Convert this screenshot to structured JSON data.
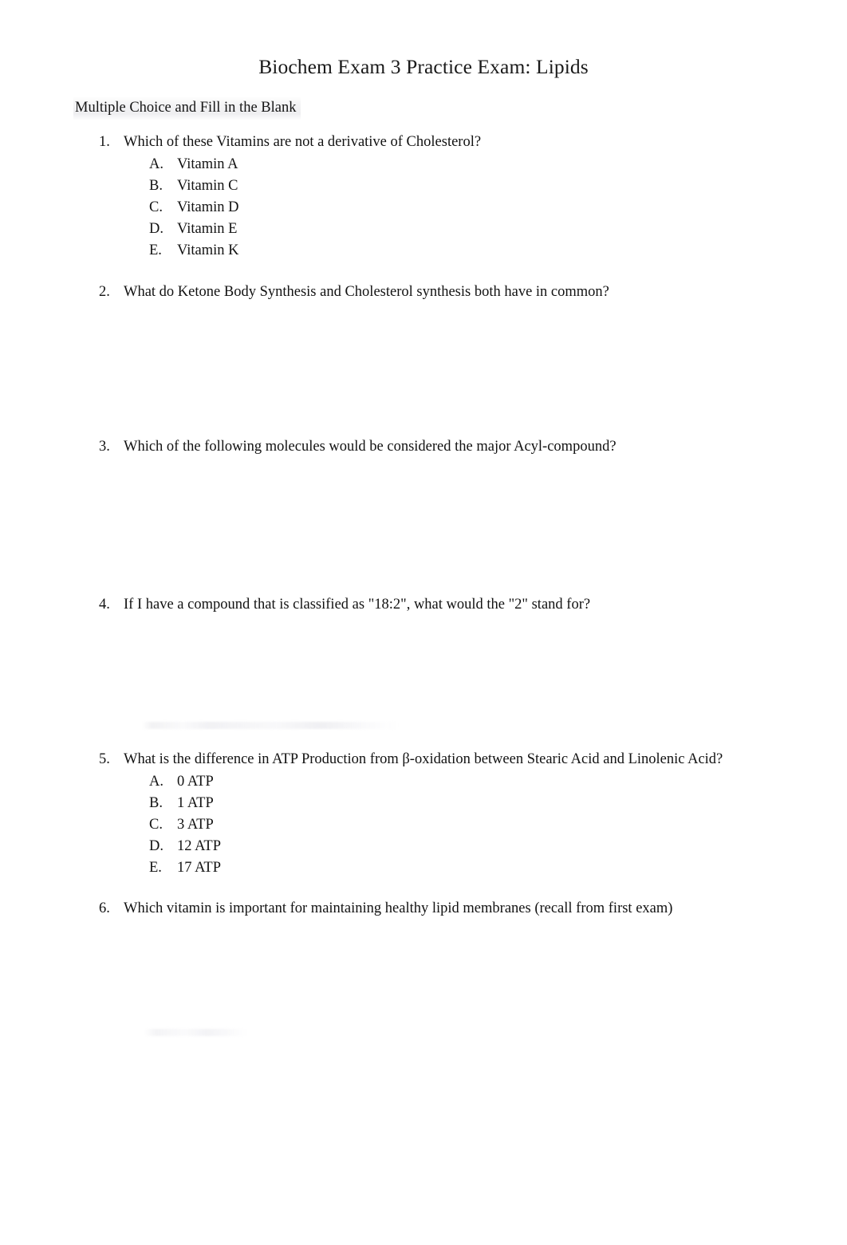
{
  "document": {
    "title": "Biochem Exam 3 Practice Exam: Lipids",
    "section_heading": "Multiple Choice and Fill in the Blank"
  },
  "questions": [
    {
      "number": "1.",
      "text": "Which of these Vitamins are not a derivative of Cholesterol?",
      "options": [
        {
          "letter": "A.",
          "text": "Vitamin A"
        },
        {
          "letter": "B.",
          "text": "Vitamin C"
        },
        {
          "letter": "C.",
          "text": "Vitamin D"
        },
        {
          "letter": "D.",
          "text": "Vitamin E"
        },
        {
          "letter": "E.",
          "text": "Vitamin K"
        }
      ]
    },
    {
      "number": "2.",
      "text": "What do Ketone Body Synthesis and Cholesterol synthesis both have in common?",
      "options": []
    },
    {
      "number": "3.",
      "text": "Which of the following molecules would be considered the major Acyl-compound?",
      "options": []
    },
    {
      "number": "4.",
      "text": "If I have a compound that is classified as \"18:2\", what would the \"2\" stand for?",
      "options": []
    },
    {
      "number": "5.",
      "text": "What is the difference in ATP Production from β-oxidation between Stearic Acid and Linolenic Acid?",
      "options": [
        {
          "letter": "A.",
          "text": "0 ATP"
        },
        {
          "letter": "B.",
          "text": "1 ATP"
        },
        {
          "letter": "C.",
          "text": "3 ATP"
        },
        {
          "letter": "D.",
          "text": "12 ATP"
        },
        {
          "letter": "E.",
          "text": "17 ATP"
        }
      ]
    },
    {
      "number": "6.",
      "text": "Which vitamin is important for maintaining healthy lipid membranes (recall from first exam)",
      "options": []
    }
  ]
}
